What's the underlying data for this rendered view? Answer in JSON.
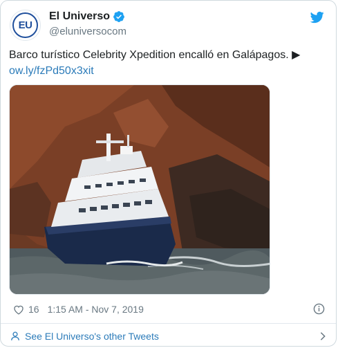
{
  "account": {
    "avatar_text": "EU",
    "name": "El Universo",
    "handle": "@eluniversocom",
    "verified_icon": "verified-badge-icon",
    "brand_color": "#1f4f9c"
  },
  "tweet": {
    "text": "Barco turístico Celebrity Xpedition encalló en Galápagos. ▶",
    "link": "ow.ly/fzPd50x3xit",
    "link_color": "#2b7bb9"
  },
  "meta": {
    "likes": "16",
    "timestamp": "1:15 AM - Nov 7, 2019"
  },
  "footer": {
    "label": "See El Universo's other Tweets"
  },
  "icons": {
    "platform": "twitter-bird-icon",
    "like": "heart-icon",
    "info": "info-icon",
    "footer": "person-icon",
    "chevron": "chevron-right-icon"
  }
}
